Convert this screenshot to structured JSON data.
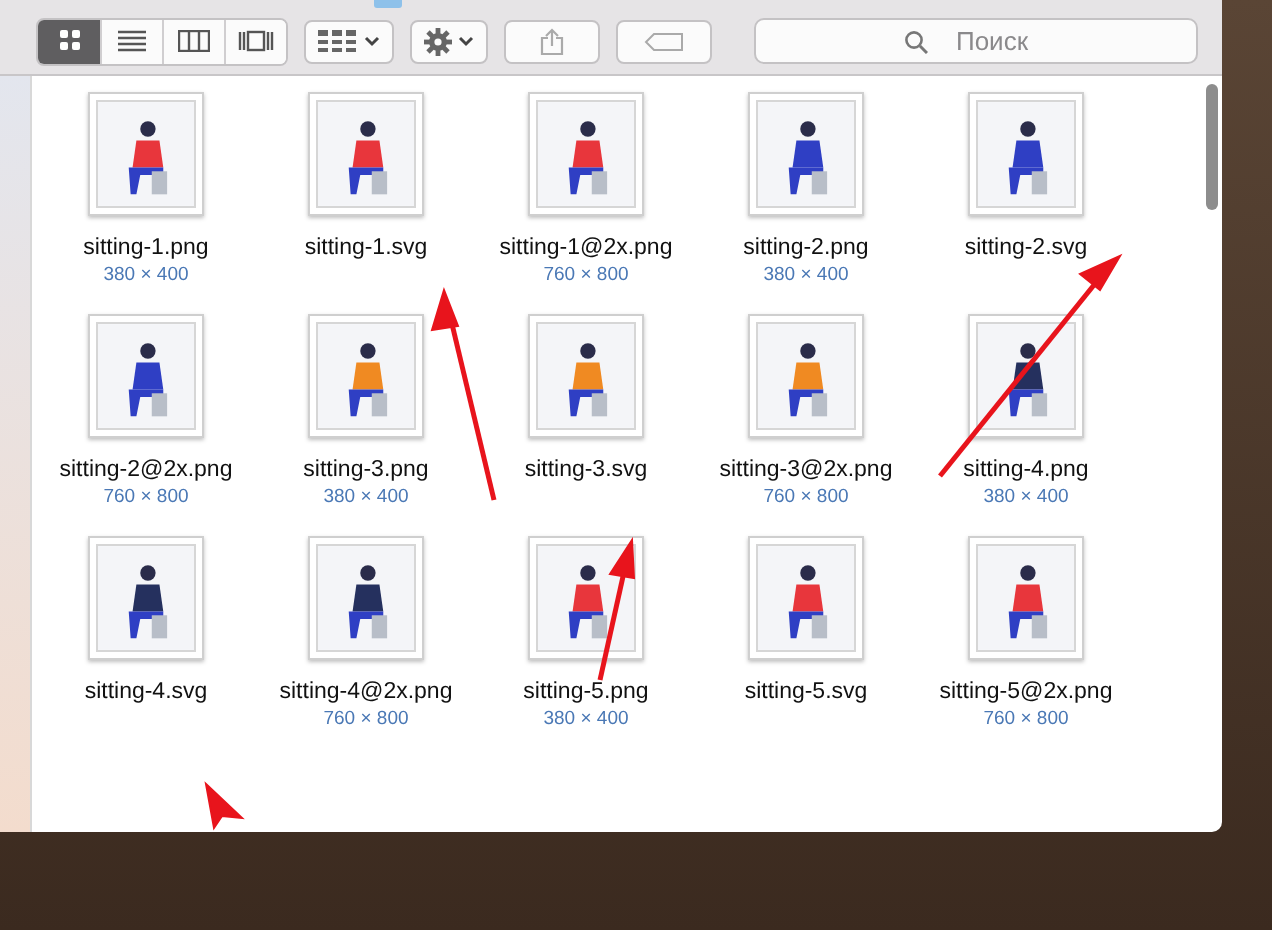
{
  "toolbar": {
    "view_modes": [
      {
        "selected": true
      },
      {
        "selected": false
      },
      {
        "selected": false
      },
      {
        "selected": false
      }
    ]
  },
  "search": {
    "placeholder": "Поиск"
  },
  "files": [
    {
      "name": "sitting-1.png",
      "dimensions": "380 × 400"
    },
    {
      "name": "sitting-1.svg"
    },
    {
      "name": "sitting-1@2x.png",
      "dimensions": "760 × 800"
    },
    {
      "name": "sitting-2.png",
      "dimensions": "380 × 400"
    },
    {
      "name": "sitting-2.svg"
    },
    {
      "name": "sitting-2@2x.png",
      "dimensions": "760 × 800"
    },
    {
      "name": "sitting-3.png",
      "dimensions": "380 × 400"
    },
    {
      "name": "sitting-3.svg"
    },
    {
      "name": "sitting-3@2x.png",
      "dimensions": "760 × 800"
    },
    {
      "name": "sitting-4.png",
      "dimensions": "380 × 400"
    },
    {
      "name": "sitting-4.svg"
    },
    {
      "name": "sitting-4@2x.png",
      "dimensions": "760 × 800"
    },
    {
      "name": "sitting-5.png",
      "dimensions": "380 × 400"
    },
    {
      "name": "sitting-5.svg"
    },
    {
      "name": "sitting-5@2x.png",
      "dimensions": "760 × 800"
    }
  ]
}
